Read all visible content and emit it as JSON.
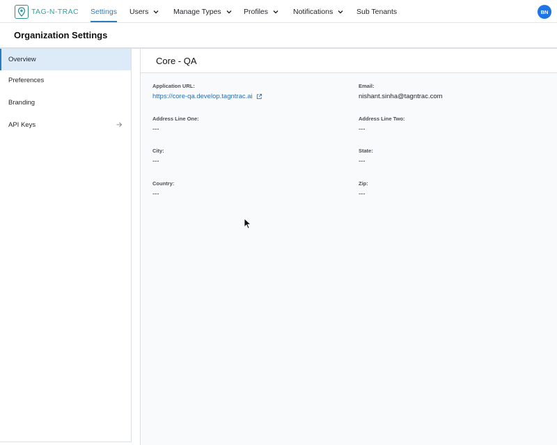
{
  "brand": {
    "logo_text": "TAG-N-TRAC"
  },
  "nav": {
    "items": [
      {
        "label": "Settings"
      },
      {
        "label": "Users"
      },
      {
        "label": "Manage Types"
      },
      {
        "label": "Profiles"
      },
      {
        "label": "Notifications"
      },
      {
        "label": "Sub Tenants"
      }
    ],
    "active_index": 0,
    "avatar_initials": "BN"
  },
  "page": {
    "title": "Organization Settings"
  },
  "sidebar": {
    "items": [
      {
        "label": "Overview"
      },
      {
        "label": "Preferences"
      },
      {
        "label": "Branding"
      },
      {
        "label": "API Keys"
      }
    ],
    "active_index": 0
  },
  "org": {
    "name": "Core - QA",
    "fields": [
      {
        "label": "Application URL:",
        "value": "https://core-qa.develop.tagntrac.ai"
      },
      {
        "label": "Email:",
        "value": "nishant.sinha@tagntrac.com"
      },
      {
        "label": "Address Line One:",
        "value": "---"
      },
      {
        "label": "Address Line Two:",
        "value": "---"
      },
      {
        "label": "City:",
        "value": "---"
      },
      {
        "label": "State:",
        "value": "---"
      },
      {
        "label": "Country:",
        "value": "---"
      },
      {
        "label": "Zip:",
        "value": "---"
      }
    ]
  },
  "colors": {
    "accent": "#2a7cc1",
    "brand_teal": "#2fa3a8",
    "avatar_bg": "#1f74e6",
    "link": "#2a6db5"
  },
  "icons": {
    "logo": "map-pin-logo-icon",
    "nav_dropdown": "chevron-down-icon",
    "api_keys": "arrow-right-icon",
    "url": "external-link-icon"
  }
}
